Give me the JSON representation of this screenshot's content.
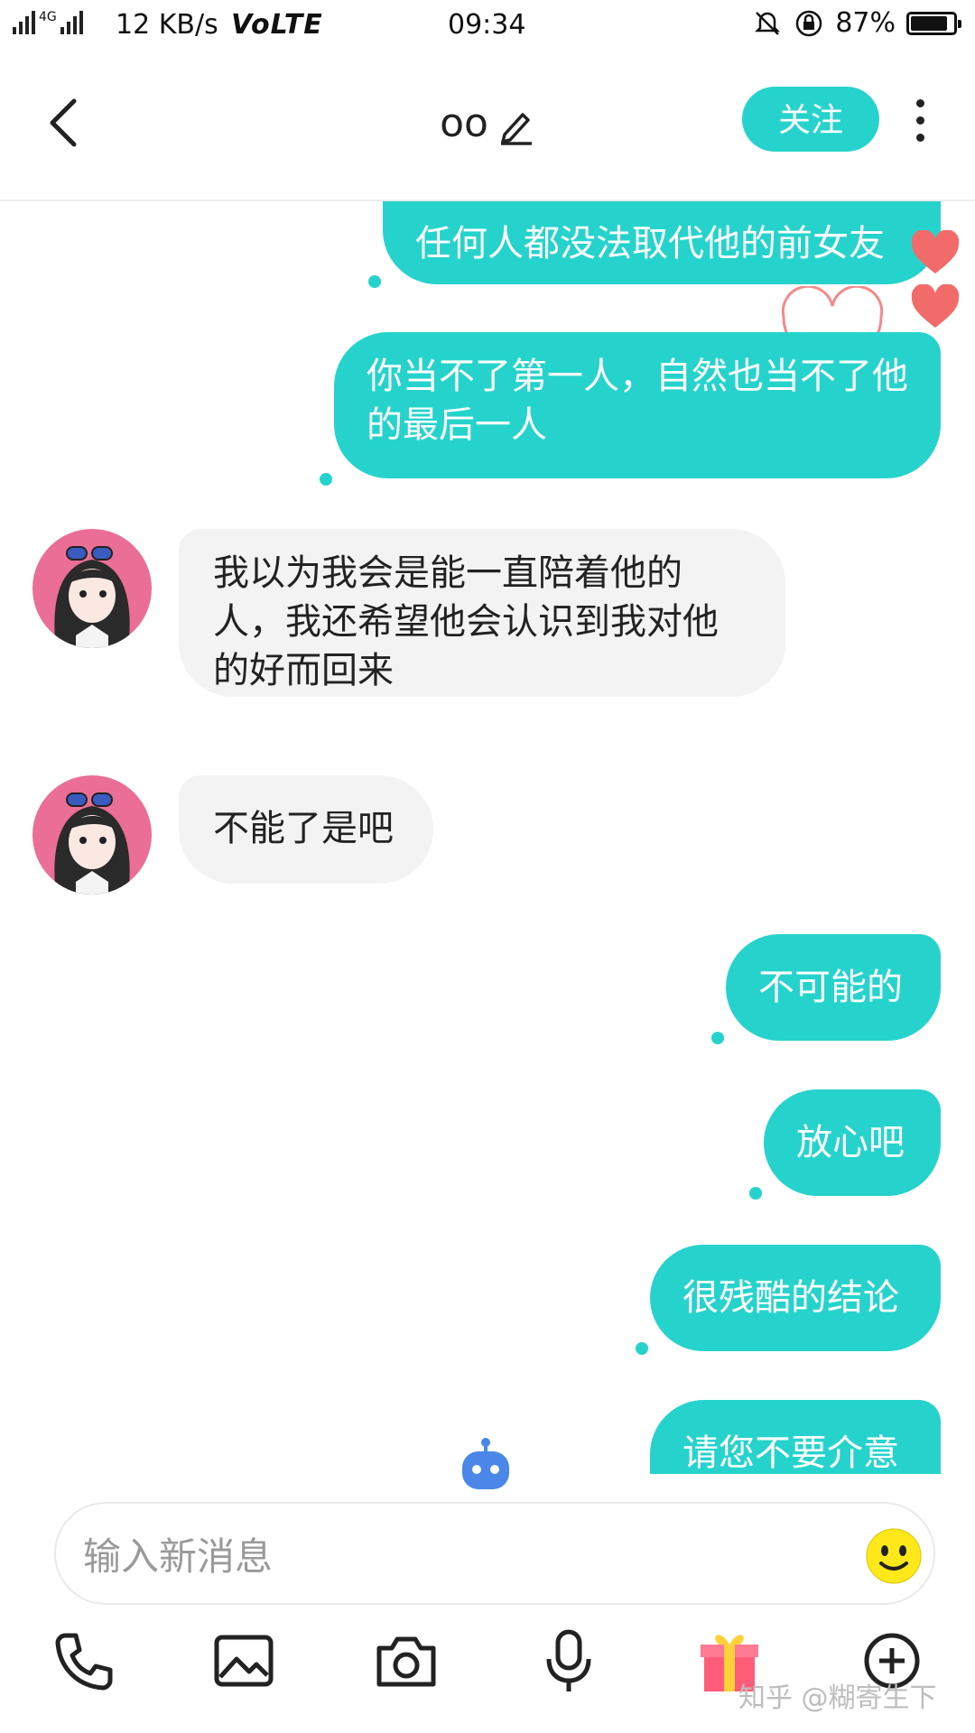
{
  "status_bar": {
    "network": "4G",
    "speed": "12 KB/s",
    "volte": "VoLTE",
    "time": "09:34",
    "battery": "87%",
    "battery_level": 0.87
  },
  "header": {
    "back_icon": "chevron-left-icon",
    "title": "oo",
    "edit_icon": "pencil-icon",
    "follow_label": "关注",
    "more_icon": "more-vertical-icon"
  },
  "messages": [
    {
      "from": "me",
      "text": "任何人都没法取代他的前女友"
    },
    {
      "from": "me",
      "text": "你当不了第一人，自然也当不了他的最后一人"
    },
    {
      "from": "other",
      "text": "我以为我会是能一直陪着他的人，我还希望他会认识到我对他的好而回来"
    },
    {
      "from": "other",
      "text": "不能了是吧"
    },
    {
      "from": "me",
      "text": "不可能的"
    },
    {
      "from": "me",
      "text": "放心吧"
    },
    {
      "from": "me",
      "text": "很残酷的结论"
    },
    {
      "from": "me",
      "text": "请您不要介意"
    }
  ],
  "input": {
    "placeholder": "输入新消息",
    "emoji_icon": "smiley-icon"
  },
  "toolbar": {
    "icons": [
      "phone-icon",
      "image-icon",
      "camera-icon",
      "microphone-icon",
      "gift-icon",
      "plus-circle-icon"
    ]
  },
  "watermark": "知乎 @糊寄生下",
  "colors": {
    "accent": "#26d3cc",
    "heart": "#f26b6b",
    "bubble_other": "#f3f3f3"
  }
}
